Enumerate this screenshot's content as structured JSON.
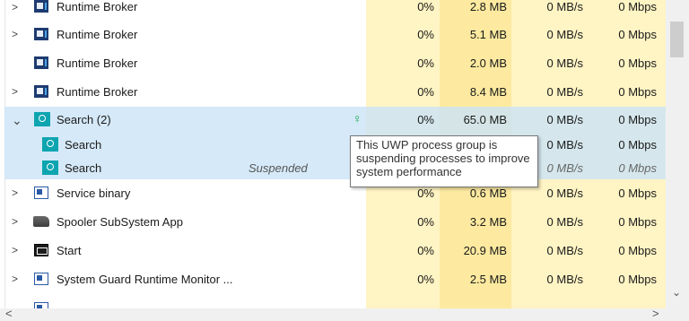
{
  "rows": [
    {
      "name": "Runtime Broker",
      "icon": "runtime-broker-icon",
      "expand": ">",
      "cpu": "0%",
      "memory": "2.8 MB",
      "disk": "0 MB/s",
      "network": "0 Mbps"
    },
    {
      "name": "Runtime Broker",
      "icon": "runtime-broker-icon",
      "expand": ">",
      "cpu": "0%",
      "memory": "5.1 MB",
      "disk": "0 MB/s",
      "network": "0 Mbps"
    },
    {
      "name": "Runtime Broker",
      "icon": "runtime-broker-icon",
      "expand": "",
      "cpu": "0%",
      "memory": "2.0 MB",
      "disk": "0 MB/s",
      "network": "0 Mbps"
    },
    {
      "name": "Runtime Broker",
      "icon": "runtime-broker-icon",
      "expand": ">",
      "cpu": "0%",
      "memory": "8.4 MB",
      "disk": "0 MB/s",
      "network": "0 Mbps"
    },
    {
      "name": "Search (2)",
      "icon": "search-icon",
      "expand": "⌄",
      "cpu": "0%",
      "memory": "65.0 MB",
      "disk": "0 MB/s",
      "network": "0 Mbps"
    },
    {
      "name": "Search",
      "icon": "search-icon",
      "expand": "",
      "status": "",
      "cpu": "",
      "memory": "",
      "disk": "0 MB/s",
      "network": "0 Mbps"
    },
    {
      "name": "Search",
      "icon": "search-icon",
      "expand": "",
      "status": "Suspended",
      "cpu": "",
      "memory": "",
      "disk": "0 MB/s",
      "network": "0 Mbps"
    },
    {
      "name": "Service binary",
      "icon": "service-icon",
      "expand": ">",
      "cpu": "0%",
      "memory": "0.6 MB",
      "disk": "0 MB/s",
      "network": "0 Mbps"
    },
    {
      "name": "Spooler SubSystem App",
      "icon": "printer-icon",
      "expand": ">",
      "cpu": "0%",
      "memory": "3.2 MB",
      "disk": "0 MB/s",
      "network": "0 Mbps"
    },
    {
      "name": "Start",
      "icon": "start-icon",
      "expand": ">",
      "cpu": "0%",
      "memory": "20.9 MB",
      "disk": "0 MB/s",
      "network": "0 Mbps"
    },
    {
      "name": "System Guard Runtime Monitor ...",
      "icon": "service-icon",
      "expand": ">",
      "cpu": "0%",
      "memory": "2.5 MB",
      "disk": "0 MB/s",
      "network": "0 Mbps"
    }
  ],
  "tooltip": {
    "text": "This UWP process group is suspending processes to improve system performance"
  },
  "icons": {
    "leaf": "leaf-icon",
    "scroll_up": "chevron-up-icon",
    "scroll_down": "chevron-down-icon",
    "scroll_left": "chevron-left-icon",
    "scroll_right": "chevron-right-icon"
  },
  "colors": {
    "selected_row": "#cce4f7",
    "cpu_column": "#fff4c4",
    "memory_column": "#fdeaa0"
  }
}
